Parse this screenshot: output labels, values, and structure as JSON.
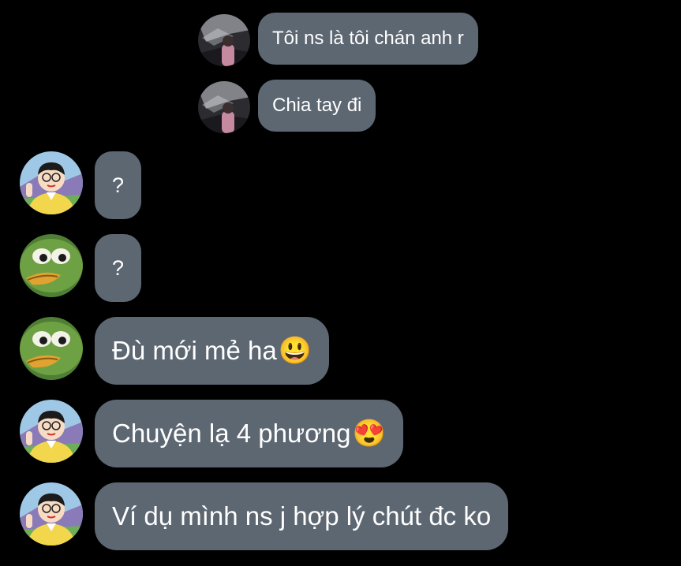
{
  "messages": [
    {
      "sender": "sent",
      "avatar": "profile-photo",
      "text": "Tôi ns là tôi chán anh r",
      "emoji": ""
    },
    {
      "sender": "sent",
      "avatar": "profile-photo",
      "text": "Chia tay đi",
      "emoji": ""
    },
    {
      "sender": "received",
      "avatar": "nobita-avatar",
      "text": "?",
      "emoji": ""
    },
    {
      "sender": "received",
      "avatar": "frog-avatar",
      "text": "?",
      "emoji": ""
    },
    {
      "sender": "received",
      "avatar": "frog-avatar",
      "text": "Đù mới mẻ ha",
      "emoji": "😃"
    },
    {
      "sender": "received",
      "avatar": "nobita-avatar",
      "text": "Chuyện lạ 4 phương",
      "emoji": "😍"
    },
    {
      "sender": "received",
      "avatar": "nobita-avatar",
      "text": "Ví dụ mình ns j hợp lý chút đc ko",
      "emoji": ""
    }
  ],
  "colors": {
    "bubble": "#5d6772",
    "background": "#000000",
    "text": "#ffffff"
  }
}
